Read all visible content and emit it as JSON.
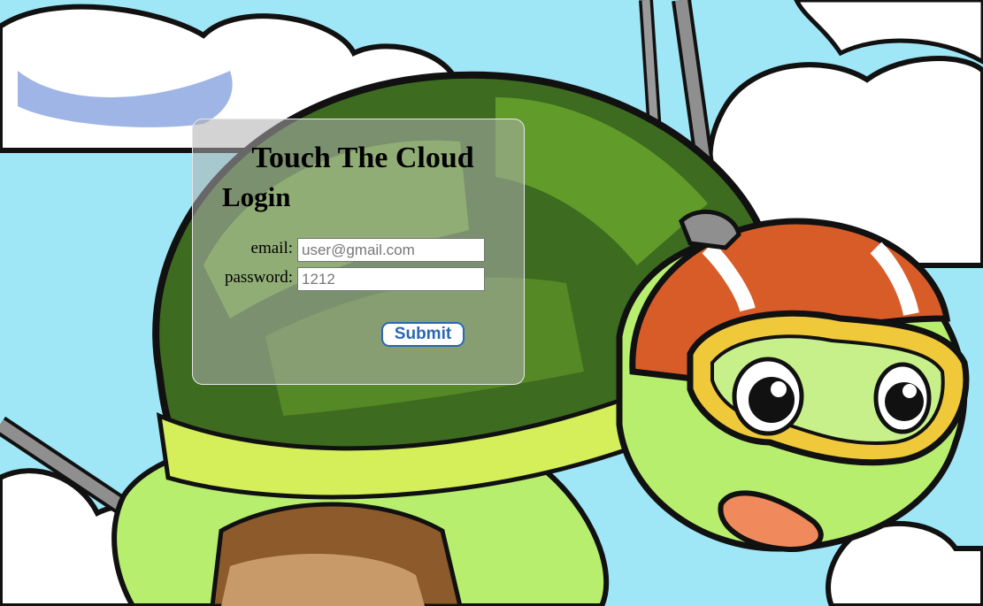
{
  "app": {
    "title": "Touch The Cloud"
  },
  "login": {
    "heading": "Login",
    "email_label": "email:",
    "email_placeholder": "user@gmail.com",
    "password_label": "password:",
    "password_placeholder": "1212",
    "submit_label": "Submit"
  },
  "background": {
    "subject": "cartoon turtle hang-gliding wearing helmet and goggles"
  },
  "colors": {
    "sky": "#9fe7f7",
    "shell_dark": "#3d6b1f",
    "shell_light": "#7fbf3a",
    "skin": "#b8ee6e",
    "helmet": "#d85c28",
    "goggles": "#f0c93a",
    "submit_accent": "#2a67b8"
  }
}
